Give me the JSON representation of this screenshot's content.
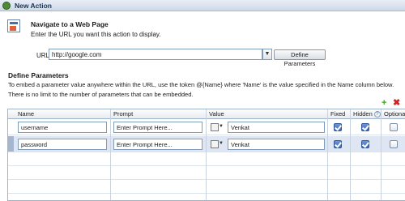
{
  "window": {
    "title": "New Action"
  },
  "navigate": {
    "title": "Navigate to a Web Page",
    "description": "Enter the URL you want this action to display."
  },
  "url": {
    "label": "URL",
    "value": "http://google.com",
    "define_button": "Define Parameters"
  },
  "params": {
    "title": "Define Parameters",
    "desc_line1": "To embed a parameter value anywhere within the URL, use the token @{Name} where 'Name' is the value specified in the Name column below.",
    "desc_line2": "There is no limit to the number of parameters that can be embedded."
  },
  "table": {
    "columns": [
      "Name",
      "Prompt",
      "Value",
      "Fixed",
      "Hidden",
      "Optional"
    ],
    "rows": [
      {
        "name": "username",
        "prompt": "Enter Prompt Here...",
        "value": "Venkat",
        "fixed": true,
        "hidden": true,
        "optional": false,
        "selected": false
      },
      {
        "name": "password",
        "prompt": "Enter Prompt Here...",
        "value": "Venkat",
        "fixed": true,
        "hidden": true,
        "optional": false,
        "selected": true
      }
    ]
  },
  "icons": {
    "title": "gear-icon",
    "navigate": "web-page-icon",
    "add": "add-icon",
    "delete": "delete-icon",
    "hidden_help": "help-icon",
    "value_picker": "value-picker-icon"
  },
  "colors": {
    "titlebar": "#cdd9e8",
    "selected_row": "#dfe6f3",
    "add": "#3aa321",
    "delete": "#d21f1f"
  }
}
